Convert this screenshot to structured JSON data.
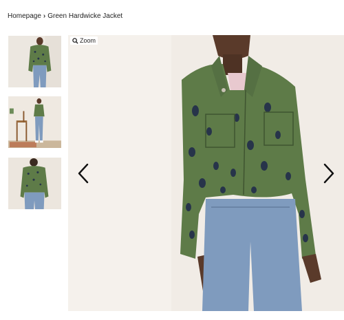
{
  "breadcrumb": {
    "home": "Homepage",
    "separator_icon": "chevron-right-icon",
    "current": "Green Hardwicke Jacket"
  },
  "gallery": {
    "thumbnails": [
      {
        "name": "thumbnail-front-view"
      },
      {
        "name": "thumbnail-full-length-view"
      },
      {
        "name": "thumbnail-back-view"
      }
    ],
    "main_image": {
      "zoom_label": "Zoom",
      "zoom_icon": "magnifier-icon",
      "prev_icon": "chevron-left-icon",
      "next_icon": "chevron-right-icon"
    }
  },
  "colors": {
    "jacket_green": "#5e7b48",
    "pattern_navy": "#27344a",
    "denim": "#7f9bbe",
    "background": "#f1ece6"
  }
}
